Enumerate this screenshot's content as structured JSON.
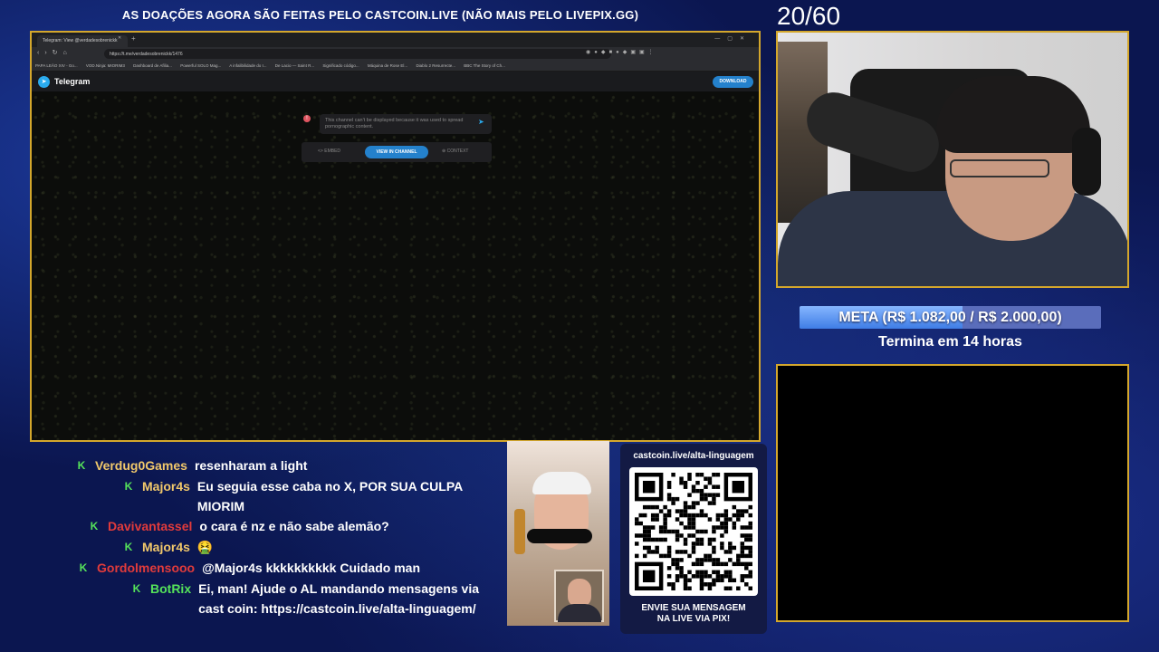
{
  "banner": {
    "text": "AS DOAÇÕES AGORA SÃO FEITAS PELO CASTCOIN.LIVE (NÃO MAIS PELO LIVEPIX.GG)"
  },
  "counter": {
    "text": "20/60"
  },
  "browser": {
    "tab_title": "Telegram: View @verdadesobrenickk",
    "url": "https://t.me/verdadesobrenickk/1476",
    "bookmarks": [
      "PAPA LEÃO XIV - Go...",
      "VOD.Ninja: MIORIM3",
      "Dashboard de Afilia...",
      "Powerful SOLO Mag...",
      "A infalibilidade do I...",
      "De Lacio — Saint R...",
      "Significado código...",
      "Máquina de Rose El...",
      "Diablo 2 Resurrecte...",
      "BBC The Story of Ch..."
    ]
  },
  "telegram": {
    "brand": "Telegram",
    "download_label": "DOWNLOAD",
    "alert_icon": "!",
    "message": "This channel can't be displayed because it was used to spread pornographic content.",
    "embed_label": "EMBED",
    "view_label": "VIEW IN CHANNEL",
    "context_label": "CONTEXT"
  },
  "goal": {
    "text": "META (R$ 1.082,00 / R$ 2.000,00)",
    "current": 1082,
    "target": 2000,
    "fill_color": "#4b86ea",
    "bg_color": "#5a6dbb"
  },
  "ends": {
    "text": "Termina em 14 horas"
  },
  "chat": {
    "badge_color": "#55e25a",
    "messages": [
      {
        "badge": "K",
        "user": "Verdug0Games",
        "user_color": "#f1c86b",
        "text": "resenharam a light"
      },
      {
        "badge": "K",
        "user": "Major4s",
        "user_color": "#f1c86b",
        "text": "Eu seguia esse caba no X, POR SUA CULPA MIORIM"
      },
      {
        "badge": "K",
        "user": "Davivantassel",
        "user_color": "#e23b3b",
        "text": "o cara é nz e não sabe alemão?"
      },
      {
        "badge": "K",
        "user": "Major4s",
        "user_color": "#f1c86b",
        "text": "🤮"
      },
      {
        "badge": "K",
        "user": "Gordolmensooo",
        "user_color": "#e23b3b",
        "text": "@Major4s kkkkkkkkkk Cuidado man"
      },
      {
        "badge": "K",
        "user": "BotRix",
        "user_color": "#55e25a",
        "text": "Ei, man! Ajude o AL mandando mensagens via cast coin: https://castcoin.live/alta-linguagem/"
      }
    ]
  },
  "qr": {
    "url_text": "castcoin.live/alta-linguagem",
    "footer_line1": "ENVIE SUA MENSAGEM",
    "footer_line2": "NA LIVE VIA PIX!"
  }
}
